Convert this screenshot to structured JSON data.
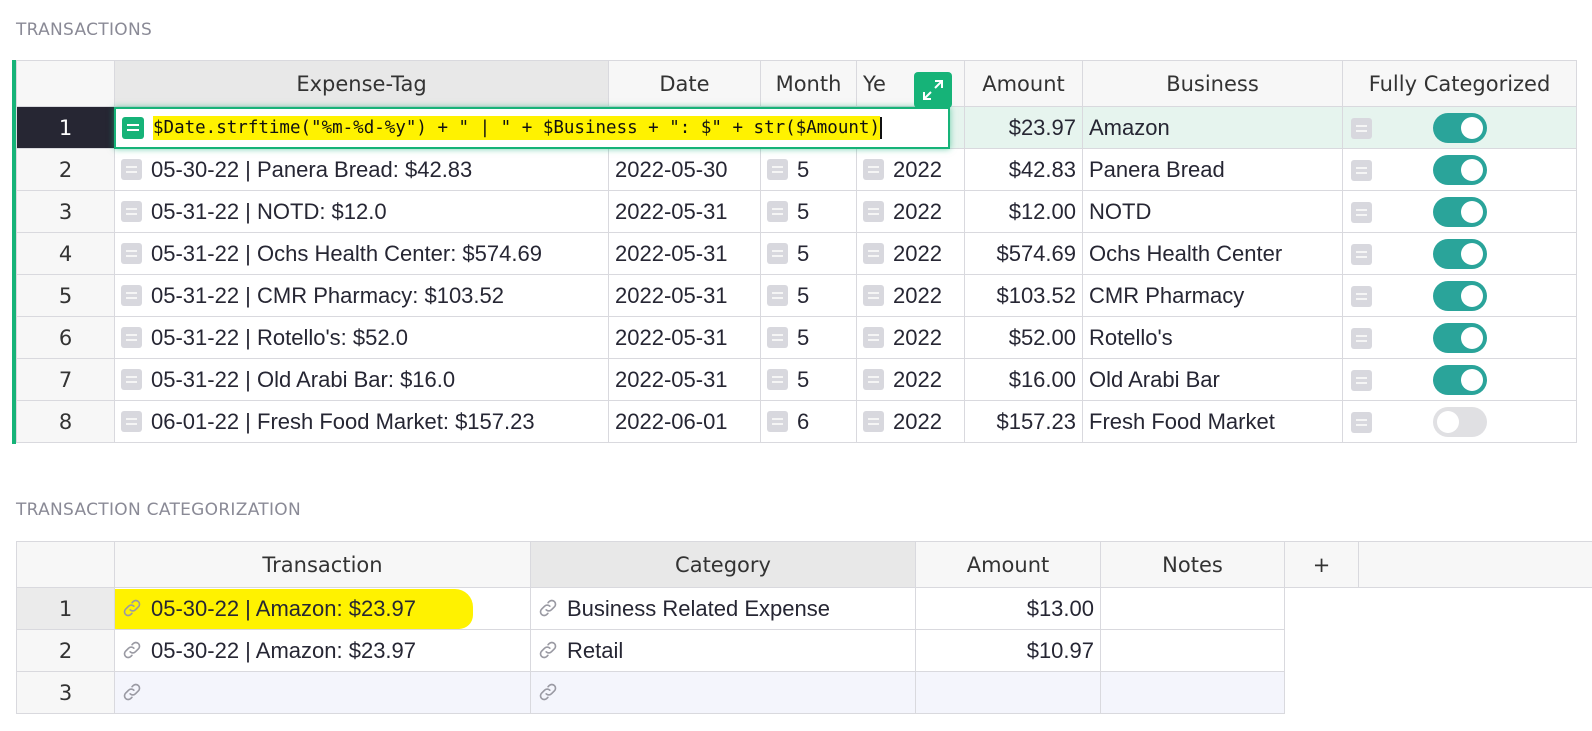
{
  "sections": {
    "transactions_title": "TRANSACTIONS",
    "categorization_title": "TRANSACTION CATEGORIZATION"
  },
  "transactions": {
    "columns": [
      "Expense-Tag",
      "Date",
      "Month",
      "Year",
      "Amount",
      "Business",
      "Fully Categorized"
    ],
    "year_header_visible": "Ye",
    "formula": "$Date.strftime(\"%m-%d-%y\") + \" | \" + $Business + \": $\" + str($Amount)",
    "rows": [
      {
        "num": "1",
        "tag": "",
        "date": "",
        "month": "",
        "year": "",
        "amount": "$23.97",
        "business": "Amazon",
        "categorized": true
      },
      {
        "num": "2",
        "tag": "05-30-22 | Panera Bread: $42.83",
        "date": "2022-05-30",
        "month": "5",
        "year": "2022",
        "amount": "$42.83",
        "business": "Panera Bread",
        "categorized": true
      },
      {
        "num": "3",
        "tag": "05-31-22 | NOTD: $12.0",
        "date": "2022-05-31",
        "month": "5",
        "year": "2022",
        "amount": "$12.00",
        "business": "NOTD",
        "categorized": true
      },
      {
        "num": "4",
        "tag": "05-31-22 | Ochs Health Center: $574.69",
        "date": "2022-05-31",
        "month": "5",
        "year": "2022",
        "amount": "$574.69",
        "business": "Ochs Health Center",
        "categorized": true
      },
      {
        "num": "5",
        "tag": "05-31-22 | CMR Pharmacy: $103.52",
        "date": "2022-05-31",
        "month": "5",
        "year": "2022",
        "amount": "$103.52",
        "business": "CMR Pharmacy",
        "categorized": true
      },
      {
        "num": "6",
        "tag": "05-31-22 | Rotello's: $52.0",
        "date": "2022-05-31",
        "month": "5",
        "year": "2022",
        "amount": "$52.00",
        "business": "Rotello's",
        "categorized": true
      },
      {
        "num": "7",
        "tag": "05-31-22 | Old Arabi Bar: $16.0",
        "date": "2022-05-31",
        "month": "5",
        "year": "2022",
        "amount": "$16.00",
        "business": "Old Arabi Bar",
        "categorized": true
      },
      {
        "num": "8",
        "tag": "06-01-22 | Fresh Food Market: $157.23",
        "date": "2022-06-01",
        "month": "6",
        "year": "2022",
        "amount": "$157.23",
        "business": "Fresh Food Market",
        "categorized": false
      }
    ]
  },
  "categorization": {
    "columns": [
      "Transaction",
      "Category",
      "Amount",
      "Notes"
    ],
    "add_column": "+",
    "rows": [
      {
        "num": "1",
        "transaction": "05-30-22 | Amazon: $23.97",
        "category": "Business Related Expense",
        "amount": "$13.00",
        "notes": ""
      },
      {
        "num": "2",
        "transaction": "05-30-22 | Amazon: $23.97",
        "category": "Retail",
        "amount": "$10.97",
        "notes": ""
      },
      {
        "num": "3",
        "transaction": "",
        "category": "",
        "amount": "",
        "notes": ""
      }
    ]
  },
  "colors": {
    "accent_green": "#16b378",
    "toggle_on": "#2aa49a",
    "highlight_yellow": "#fff200"
  },
  "icons": [
    "formula-icon",
    "expand-icon",
    "reference-link-icon",
    "choice-chip-icon"
  ]
}
